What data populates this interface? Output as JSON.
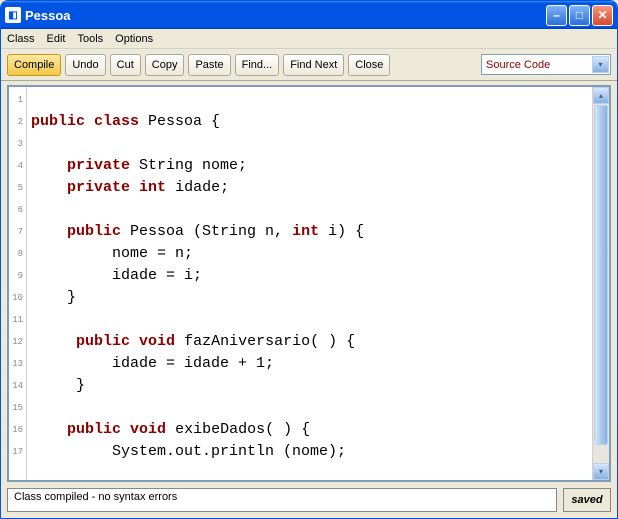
{
  "window": {
    "title": "Pessoa"
  },
  "menu": {
    "class": "Class",
    "edit": "Edit",
    "tools": "Tools",
    "options": "Options"
  },
  "toolbar": {
    "compile": "Compile",
    "undo": "Undo",
    "cut": "Cut",
    "copy": "Copy",
    "paste": "Paste",
    "find": "Find...",
    "findnext": "Find Next",
    "close": "Close"
  },
  "dropdown": {
    "selected": "Source Code"
  },
  "code": {
    "lines": [
      {
        "n": "1",
        "tokens": []
      },
      {
        "n": "2",
        "tokens": [
          {
            "t": "public",
            "k": true
          },
          {
            "t": " "
          },
          {
            "t": "class",
            "k": true
          },
          {
            "t": " Pessoa {"
          }
        ]
      },
      {
        "n": "3",
        "tokens": []
      },
      {
        "n": "4",
        "tokens": [
          {
            "t": "    "
          },
          {
            "t": "private",
            "k": true
          },
          {
            "t": " String nome;"
          }
        ]
      },
      {
        "n": "5",
        "tokens": [
          {
            "t": "    "
          },
          {
            "t": "private",
            "k": true
          },
          {
            "t": " "
          },
          {
            "t": "int",
            "k": true
          },
          {
            "t": " idade;"
          }
        ]
      },
      {
        "n": "6",
        "tokens": []
      },
      {
        "n": "7",
        "tokens": [
          {
            "t": "    "
          },
          {
            "t": "public",
            "k": true
          },
          {
            "t": " Pessoa (String n, "
          },
          {
            "t": "int",
            "k": true
          },
          {
            "t": " i) {"
          }
        ]
      },
      {
        "n": "8",
        "tokens": [
          {
            "t": "         nome = n;"
          }
        ]
      },
      {
        "n": "9",
        "tokens": [
          {
            "t": "         idade = i;"
          }
        ]
      },
      {
        "n": "10",
        "tokens": [
          {
            "t": "    }"
          }
        ]
      },
      {
        "n": "11",
        "tokens": []
      },
      {
        "n": "12",
        "tokens": [
          {
            "t": "     "
          },
          {
            "t": "public",
            "k": true
          },
          {
            "t": " "
          },
          {
            "t": "void",
            "k": true
          },
          {
            "t": " fazAniversario( ) {"
          }
        ]
      },
      {
        "n": "13",
        "tokens": [
          {
            "t": "         idade = idade + 1;"
          }
        ]
      },
      {
        "n": "14",
        "tokens": [
          {
            "t": "     }"
          }
        ]
      },
      {
        "n": "15",
        "tokens": []
      },
      {
        "n": "16",
        "tokens": [
          {
            "t": "    "
          },
          {
            "t": "public",
            "k": true
          },
          {
            "t": " "
          },
          {
            "t": "void",
            "k": true
          },
          {
            "t": " exibeDados( ) {"
          }
        ]
      },
      {
        "n": "17",
        "tokens": [
          {
            "t": "         System.out.println (nome);"
          }
        ]
      }
    ]
  },
  "status": {
    "message": "Class compiled - no syntax errors",
    "saved": "saved"
  }
}
